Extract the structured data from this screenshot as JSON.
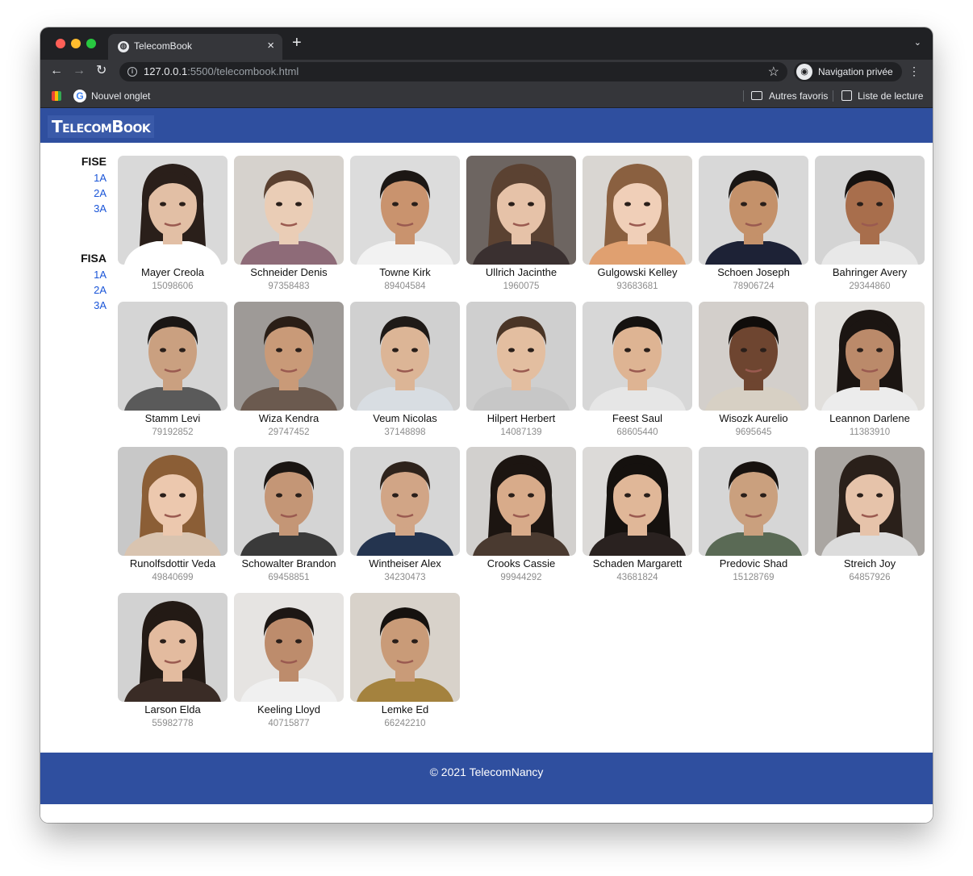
{
  "browser": {
    "tab_title": "TelecomBook",
    "url_host": "127.0.0.1",
    "url_path": ":5500/telecombook.html",
    "profile_label": "Navigation privée",
    "bookmarks": {
      "new_tab": "Nouvel onglet",
      "other": "Autres favoris",
      "reading_list": "Liste de lecture"
    }
  },
  "site": {
    "brand": "TelecomBook",
    "footer": "© 2021 TelecomNancy"
  },
  "sidebar": {
    "groups": [
      {
        "title": "FISE",
        "links": [
          "1A",
          "2A",
          "3A"
        ]
      },
      {
        "title": "FISA",
        "links": [
          "1A",
          "2A",
          "3A"
        ]
      }
    ]
  },
  "people": [
    {
      "name": "Mayer Creola",
      "id": "15098606",
      "skin": "#e2bfa5",
      "hair": "#2a1f1a",
      "bg": "#d9d9d9",
      "shirt": "#ffffff",
      "long_hair": true
    },
    {
      "name": "Schneider Denis",
      "id": "97358483",
      "skin": "#eacdb6",
      "hair": "#5a4030",
      "bg": "#d6d2cd",
      "shirt": "#8e6b78",
      "long_hair": false
    },
    {
      "name": "Towne Kirk",
      "id": "89404584",
      "skin": "#c9936e",
      "hair": "#1c1714",
      "bg": "#dcdcdc",
      "shirt": "#f2f2f2",
      "long_hair": false
    },
    {
      "name": "Ullrich Jacinthe",
      "id": "1960075",
      "skin": "#e6c2a8",
      "hair": "#5b4232",
      "bg": "#6d6561",
      "shirt": "#3a3030",
      "long_hair": true
    },
    {
      "name": "Gulgowski Kelley",
      "id": "93683681",
      "skin": "#f0cfb8",
      "hair": "#8a6040",
      "bg": "#d9d6d2",
      "shirt": "#e0a070",
      "long_hair": true
    },
    {
      "name": "Schoen Joseph",
      "id": "78906724",
      "skin": "#c4916a",
      "hair": "#1a1614",
      "bg": "#d8d8d8",
      "shirt": "#1d2236",
      "long_hair": false
    },
    {
      "name": "Bahringer Avery",
      "id": "29344860",
      "skin": "#a86e4c",
      "hair": "#15110f",
      "bg": "#d4d4d4",
      "shirt": "#e8e8e8",
      "long_hair": false
    },
    {
      "name": "Stamm Levi",
      "id": "79192852",
      "skin": "#caa080",
      "hair": "#1a1614",
      "bg": "#d5d5d5",
      "shirt": "#5a5a5a",
      "long_hair": false
    },
    {
      "name": "Wiza Kendra",
      "id": "29747452",
      "skin": "#c99a78",
      "hair": "#2a1e16",
      "bg": "#9e9a97",
      "shirt": "#6b5a4f",
      "long_hair": false
    },
    {
      "name": "Veum Nicolas",
      "id": "37148898",
      "skin": "#dcb596",
      "hair": "#1f1a17",
      "bg": "#d0d0d0",
      "shirt": "#d8dde2",
      "long_hair": false
    },
    {
      "name": "Hilpert Herbert",
      "id": "14087139",
      "skin": "#e3bea0",
      "hair": "#4a3526",
      "bg": "#cfcfcf",
      "shirt": "#c7c7c7",
      "long_hair": false
    },
    {
      "name": "Feest Saul",
      "id": "68605440",
      "skin": "#deb493",
      "hair": "#151210",
      "bg": "#d7d7d7",
      "shirt": "#e6e6e6",
      "long_hair": false
    },
    {
      "name": "Wisozk Aurelio",
      "id": "9695645",
      "skin": "#6e4530",
      "hair": "#0f0c0a",
      "bg": "#d3cfcb",
      "shirt": "#d7d0c4",
      "long_hair": false
    },
    {
      "name": "Leannon Darlene",
      "id": "11383910",
      "skin": "#bb8a6a",
      "hair": "#1b1512",
      "bg": "#e1dfdc",
      "shirt": "#ececec",
      "long_hair": true
    },
    {
      "name": "Runolfsdottir Veda",
      "id": "49840699",
      "skin": "#ecc8ae",
      "hair": "#8b5e36",
      "bg": "#c8c8c8",
      "shirt": "#d9c4b0",
      "long_hair": true
    },
    {
      "name": "Schowalter Brandon",
      "id": "69458851",
      "skin": "#c49676",
      "hair": "#1a1512",
      "bg": "#d4d4d4",
      "shirt": "#3a3a3a",
      "long_hair": false
    },
    {
      "name": "Wintheiser Alex",
      "id": "34230473",
      "skin": "#d1a586",
      "hair": "#2e231c",
      "bg": "#d6d6d6",
      "shirt": "#24344f",
      "long_hair": false
    },
    {
      "name": "Crooks Cassie",
      "id": "99944292",
      "skin": "#d8ab8a",
      "hair": "#1c1511",
      "bg": "#d2d0ce",
      "shirt": "#4a3a30",
      "long_hair": true
    },
    {
      "name": "Schaden Margarett",
      "id": "43681824",
      "skin": "#e0b798",
      "hair": "#15110e",
      "bg": "#dcdad8",
      "shirt": "#2a2220",
      "long_hair": true
    },
    {
      "name": "Predovic Shad",
      "id": "15128769",
      "skin": "#caa07e",
      "hair": "#17120f",
      "bg": "#d6d6d6",
      "shirt": "#5a6a55",
      "long_hair": false
    },
    {
      "name": "Streich Joy",
      "id": "64857926",
      "skin": "#e6c3aa",
      "hair": "#2a201a",
      "bg": "#aaa6a2",
      "shirt": "#dcdcdc",
      "long_hair": true
    },
    {
      "name": "Larson Elda",
      "id": "55982778",
      "skin": "#e3bb9f",
      "hair": "#231a15",
      "bg": "#d2d2d2",
      "shirt": "#3a2c26",
      "long_hair": true
    },
    {
      "name": "Keeling Lloyd",
      "id": "40715877",
      "skin": "#bd8c6c",
      "hair": "#1d1714",
      "bg": "#e6e4e2",
      "shirt": "#f0f0f0",
      "long_hair": false
    },
    {
      "name": "Lemke Ed",
      "id": "66242210",
      "skin": "#c99b78",
      "hair": "#16120f",
      "bg": "#d8d2ca",
      "shirt": "#a4823e",
      "long_hair": false
    }
  ]
}
